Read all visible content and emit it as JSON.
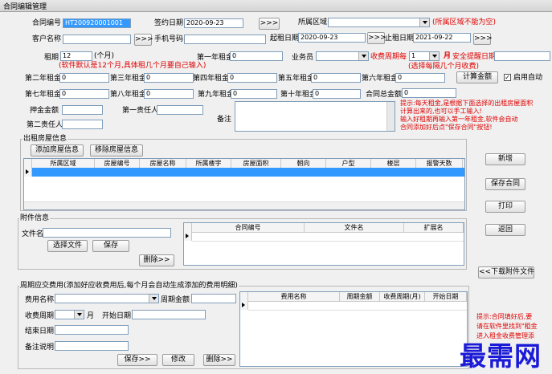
{
  "window": {
    "title": "合同编辑管理"
  },
  "row1": {
    "contract_no_label": "合同编号",
    "contract_no_value": "HT200920001001",
    "sign_date_label": "签约日期",
    "sign_date_value": "2020-09-23",
    "more_btn": ">>>",
    "region_label": "所属区域",
    "region_note": "(所属区域不能为空)"
  },
  "row2": {
    "customer_label": "客户名称",
    "customer_btn": ">>>",
    "phone_label": "手机号码",
    "start_label": "起租日期",
    "start_value": "2020-09-23",
    "start_btn": ">>>",
    "end_label": "止租日期",
    "end_value": "2021-09-22",
    "end_btn": ">>>"
  },
  "row3": {
    "term_label": "租期",
    "term_value": "12",
    "term_unit": "(个月)",
    "term_note": "(软件默认是12个月,具体租几个月要自己输入)",
    "rent1_label": "第一年租金",
    "rent1_value": "0",
    "salesman_label": "业务员",
    "cycle_label": "收费周期每",
    "cycle_value": "1",
    "cycle_unit": "月",
    "remind_label": "安全提醒日期",
    "cycle_note": "(选择每隔几个月收费)"
  },
  "rents": {
    "rent2_label": "第二年租金",
    "rent2_value": "0",
    "rent3_label": "第三年租金",
    "rent3_value": "0",
    "rent4_label": "第四年租金",
    "rent4_value": "0",
    "rent5_label": "第五年租金",
    "rent5_value": "0",
    "rent6_label": "第六年租金",
    "rent6_value": "0",
    "rent7_label": "第七年租金",
    "rent7_value": "0",
    "rent8_label": "第八年租金",
    "rent8_value": "0",
    "rent9_label": "第九年租金",
    "rent9_value": "0",
    "rent10_label": "第十年租金",
    "rent10_value": "0",
    "total_label": "合同总金额",
    "total_value": "0",
    "calc_btn": "计算金额",
    "auto_label": "启用自动"
  },
  "misc": {
    "deposit_label": "押金金额",
    "resp1_label": "第一责任人",
    "resp2_label": "第二责任人",
    "remark_label": "备注"
  },
  "tip1": "提示:每天租金,是根据下面选择的出租房屋面积\n计算出来的,也可以手工输入!\n输入好租期再输入第一年租金,软件会自动\n合同添加好后点\"保存合同\"按钮!",
  "rental_section": {
    "title": "出租房屋信息",
    "add_btn": "添加房屋信息",
    "remove_btn": "移除房屋信息",
    "columns": [
      "所属区域",
      "房屋编号",
      "房屋名称",
      "所属楼宇",
      "房屋面积",
      "朝向",
      "户型",
      "楼层",
      "报警天数"
    ]
  },
  "right_buttons": {
    "new": "新增",
    "save": "保存合同",
    "print": "打印",
    "back": "返回",
    "download": "<<下载附件文件"
  },
  "attachment": {
    "title": "附件信息",
    "file_label": "文件名",
    "select_btn": "选择文件",
    "save_btn": "保存",
    "delete_btn": "删除>>",
    "columns": [
      "合同编号",
      "文件名",
      "扩展名"
    ]
  },
  "fees": {
    "title": "周期应交费用(添加好应收费用后,每个月会自动生成添加的费用明细)",
    "fee_name_label": "费用名称",
    "amount_label": "周期金额",
    "cycle_label": "收费周期",
    "cycle_unit": "月",
    "start_label": "开始日期",
    "end_label": "结束日期",
    "remark_label": "备注说明",
    "save_btn": "保存>>",
    "edit_btn": "修改",
    "delete_btn": "删除>>",
    "columns": [
      "费用名称",
      "周期金额",
      "收费周期(月)",
      "开始日期"
    ],
    "tip": "提示:合同填好后,要\n请在软件里找到\"租金\n进入租金收费管理添"
  },
  "watermark": "最需网"
}
